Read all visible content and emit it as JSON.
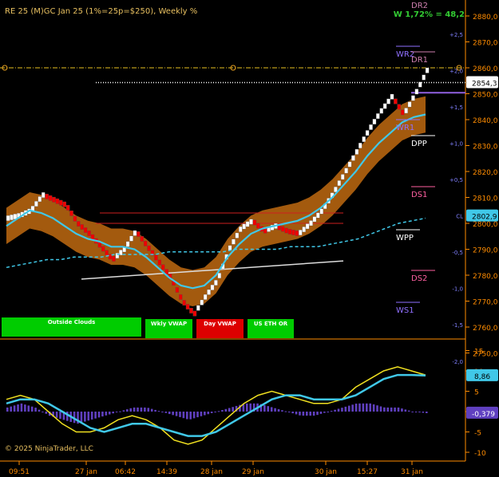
{
  "header": {
    "title": "RE 25 (M)GC Jan 25 (1%=25p=$250), Weekly %"
  },
  "weekly_info": "W 1,72% = 48,2",
  "copyright": "© 2025 NinjaTrader, LLC",
  "tags": [
    {
      "label": "Outside Clouds",
      "color": "#00cc00"
    },
    {
      "label": "Wkly VWAP",
      "color": "#00cc00"
    },
    {
      "label": "Day VWAP",
      "color": "#dd0000"
    },
    {
      "label": "US ETH OR",
      "color": "#00cc00"
    }
  ],
  "price_tick_labels": [
    "2880,0",
    "2870,0",
    "2860,0",
    "2850,0",
    "2840,0",
    "2830,0",
    "2820,0",
    "2810,0",
    "2800,0",
    "2790,0",
    "2780,0",
    "2770,0",
    "2760,0",
    "2750,0"
  ],
  "percent_labels": [
    "+2,5",
    "+2,0",
    "+1,5",
    "+1,0",
    "+0,5",
    "CL",
    "-0,5",
    "-1,0",
    "-1,5",
    "-2,0"
  ],
  "osc_tick_labels": [
    "15",
    "10",
    "5",
    "0",
    "-5",
    "-10"
  ],
  "x_tick_labels": [
    "09:51",
    "27 jan",
    "06:42",
    "14:39",
    "28 jan",
    "29 jan",
    "30 jan",
    "15:27",
    "31 jan"
  ],
  "pivot_labels": [
    "DR2",
    "WR2",
    "DR1",
    "WR1",
    "DPP",
    "DS1",
    "WPP",
    "DS2",
    "WS1"
  ],
  "last_price_label": "2854,3",
  "close_label": "2802,9",
  "osc_value_label": "8,86",
  "hist_value_label": "-0,379",
  "colors": {
    "up_brick": "#ffffff",
    "down_brick": "#ee0000",
    "cloud": "#c06a10",
    "vwap": "#40c8e8",
    "axis": "#ff8c00"
  },
  "chart_data": [
    {
      "type": "line",
      "title": "RE 25 (M)GC Jan 25 (1%=25p=$250), Weekly %",
      "x": [
        "09:51",
        "27 jan",
        "06:42",
        "14:39",
        "28 jan",
        "29 jan",
        "30 jan",
        "15:27",
        "31 jan"
      ],
      "ylim": [
        2745,
        2887
      ],
      "series": [
        {
          "values": [
            2802,
            2803,
            2805,
            2811,
            2809,
            2807,
            2800,
            2796,
            2791,
            2786,
            2790,
            2797,
            2791,
            2785,
            2779,
            2770,
            2765,
            2772,
            2778,
            2790,
            2798,
            2801,
            2797,
            2799,
            2797,
            2796,
            2800,
            2805,
            2812,
            2820,
            2828,
            2836,
            2843,
            2849,
            2842,
            2850,
            2859
          ]
        },
        {
          "values": [
            2799,
            2802,
            2805,
            2804,
            2802,
            2799,
            2796,
            2794,
            2793,
            2791,
            2791,
            2790,
            2787,
            2783,
            2779,
            2776,
            2775,
            2776,
            2780,
            2787,
            2792,
            2796,
            2798,
            2799,
            2800,
            2801,
            2803,
            2806,
            2810,
            2815,
            2820,
            2826,
            2831,
            2835,
            2839,
            2841,
            2842
          ]
        },
        {
          "values": [
            2783,
            2784,
            2785,
            2786,
            2786,
            2787,
            2787,
            2787,
            2788,
            2788,
            2788,
            2788,
            2789,
            2789,
            2789,
            2789,
            2789,
            2790,
            2790,
            2790,
            2790,
            2791,
            2791,
            2791,
            2792,
            2793,
            2794,
            2796,
            2798,
            2800,
            2801,
            2802
          ]
        }
      ],
      "annotations": [
        "Outside Clouds",
        "Wkly VWAP",
        "Day VWAP",
        "US ETH OR"
      ]
    },
    {
      "type": "line",
      "ylim": [
        -12,
        17
      ],
      "series": [
        {
          "values": [
            3,
            4,
            3,
            0,
            -3,
            -5,
            -5,
            -4,
            -2,
            -1,
            -2,
            -4,
            -7,
            -8,
            -7,
            -4,
            -1,
            2,
            4,
            5,
            4,
            3,
            2,
            2,
            3,
            6,
            8,
            10,
            11,
            10,
            9
          ]
        },
        {
          "values": [
            2,
            3,
            3,
            2,
            0,
            -2,
            -4,
            -5,
            -4,
            -3,
            -3,
            -4,
            -5,
            -6,
            -6,
            -5,
            -3,
            -1,
            1,
            3,
            4,
            4,
            3,
            3,
            3,
            4,
            6,
            8,
            9,
            9,
            8.86
          ]
        },
        {
          "values": [
            1,
            2,
            1,
            -1,
            -2,
            -3,
            -2,
            -1,
            0,
            1,
            1,
            0,
            -1,
            -2,
            -1,
            0,
            1,
            2,
            2,
            1,
            0,
            -1,
            -1,
            0,
            1,
            2,
            2,
            1,
            1,
            0,
            -0.379
          ]
        }
      ]
    }
  ]
}
